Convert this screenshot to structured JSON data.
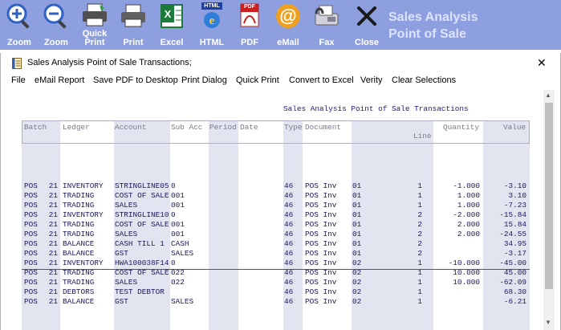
{
  "toolbar": {
    "buttons": [
      {
        "label": "Zoom",
        "icon": "zoom-in-icon"
      },
      {
        "label": "Zoom",
        "icon": "zoom-out-icon"
      },
      {
        "label": "Quick\nPrint",
        "icon": "quick-print-icon"
      },
      {
        "label": "Print",
        "icon": "printer-icon"
      },
      {
        "label": "Excel",
        "icon": "excel-icon"
      },
      {
        "label": "HTML",
        "icon": "html-icon"
      },
      {
        "label": "PDF",
        "icon": "pdf-icon"
      },
      {
        "label": "eMail",
        "icon": "email-icon"
      },
      {
        "label": "Fax",
        "icon": "fax-icon"
      },
      {
        "label": "Close",
        "icon": "close-x-icon"
      }
    ],
    "html_badge": "HTML",
    "pdf_badge": "PDF",
    "brand_line1": "Sales Analysis",
    "brand_line2": "Point of Sale"
  },
  "window": {
    "title": "Sales Analysis Point of Sale Transactions;",
    "close_glyph": "✕"
  },
  "menu": [
    "File",
    "eMail Report",
    "Save PDF to Desktop",
    "Print Dialog",
    "Quick Print",
    "Convert to Excel",
    "Verity",
    "Clear Selections"
  ],
  "report": {
    "title": "Sales Analysis Point of Sale Transactions",
    "headers": {
      "batch": "Batch",
      "ledger": "Ledger",
      "account": "Account",
      "sub_acc": "Sub Acc",
      "period": "Period",
      "date": "Date",
      "type": "Type",
      "document": "Document",
      "line": "Line",
      "quantity": "Quantity",
      "value": "Value"
    },
    "rows": [
      [
        "POS",
        "21",
        "INVENTORY",
        "STRINGLINE05",
        "0",
        "",
        "46",
        "POS Inv",
        "01",
        "1",
        "-1.000",
        "-3.10"
      ],
      [
        "POS",
        "21",
        "TRADING",
        "COST OF SALE",
        "001",
        "",
        "46",
        "POS Inv",
        "01",
        "1",
        "1.000",
        "3.10"
      ],
      [
        "POS",
        "21",
        "TRADING",
        "SALES",
        "001",
        "",
        "46",
        "POS Inv",
        "01",
        "1",
        "1.000",
        "-7.23"
      ],
      [
        "POS",
        "21",
        "INVENTORY",
        "STRINGLINE10",
        "0",
        "",
        "46",
        "POS Inv",
        "01",
        "2",
        "-2.000",
        "-15.84"
      ],
      [
        "POS",
        "21",
        "TRADING",
        "COST OF SALE",
        "001",
        "",
        "46",
        "POS Inv",
        "01",
        "2",
        "2.000",
        "15.84"
      ],
      [
        "POS",
        "21",
        "TRADING",
        "SALES",
        "001",
        "",
        "46",
        "POS Inv",
        "01",
        "2",
        "2.000",
        "-24.55"
      ],
      [
        "POS",
        "21",
        "BALANCE",
        "CASH TILL 1",
        "CASH",
        "",
        "46",
        "POS Inv",
        "01",
        "2",
        "",
        "34.95"
      ],
      [
        "POS",
        "21",
        "BALANCE",
        "GST",
        "SALES",
        "",
        "46",
        "POS Inv",
        "01",
        "2",
        "",
        "-3.17"
      ],
      [
        "POS",
        "21",
        "INVENTORY",
        "HWA100038F14",
        "0",
        "",
        "46",
        "POS Inv",
        "02",
        "1",
        "-10.000",
        "-45.00"
      ],
      [
        "POS",
        "21",
        "TRADING",
        "COST OF SALE",
        "022",
        "",
        "46",
        "POS Inv",
        "02",
        "1",
        "10.000",
        "45.00"
      ],
      [
        "POS",
        "21",
        "TRADING",
        "SALES",
        "022",
        "",
        "46",
        "POS Inv",
        "02",
        "1",
        "10.000",
        "-62.09"
      ],
      [
        "POS",
        "21",
        "DEBTORS",
        "TEST DEBTOR",
        "",
        "",
        "46",
        "POS Inv",
        "02",
        "1",
        "",
        "68.30"
      ],
      [
        "POS",
        "21",
        "BALANCE",
        "GST",
        "SALES",
        "",
        "46",
        "POS Inv",
        "02",
        "1",
        "",
        "-6.21"
      ]
    ]
  },
  "colors": {
    "toolbar_bg": "#8e9fe0",
    "column_shade": "#e2e4f0",
    "separator": "#b03030"
  }
}
